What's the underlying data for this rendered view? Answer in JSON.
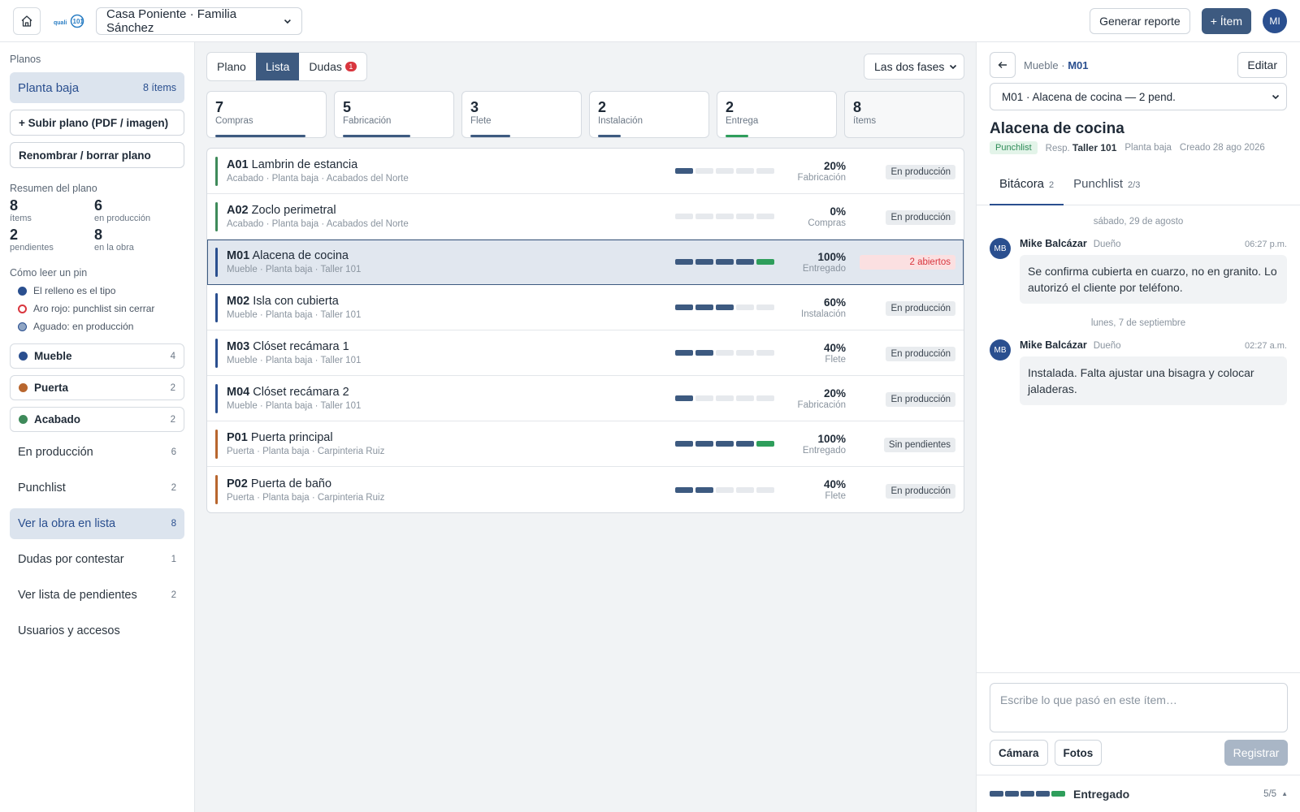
{
  "topbar": {
    "logo_text": "quali101",
    "project": "Casa Poniente · Familia Sánchez",
    "report_button": "Generar reporte",
    "add_item_button": "+ Ítem",
    "user_initials": "MI"
  },
  "sidebar": {
    "plans_heading": "Planos",
    "active_plan": {
      "name": "Planta baja",
      "count": "8 ítems"
    },
    "upload_button": "+ Subir plano (PDF / imagen)",
    "rename_button": "Renombrar / borrar plano",
    "summary_heading": "Resumen del plano",
    "summary": [
      {
        "value": "8",
        "label": "ítems"
      },
      {
        "value": "6",
        "label": "en producción"
      },
      {
        "value": "2",
        "label": "pendientes"
      },
      {
        "value": "8",
        "label": "en la obra"
      }
    ],
    "legend_heading": "Cómo leer un pin",
    "legend": [
      {
        "text": "El relleno es el tipo"
      },
      {
        "text": "Aro rojo: punchlist sin cerrar"
      },
      {
        "text": "Aguado: en producción"
      }
    ],
    "types": [
      {
        "name": "Mueble",
        "count": "4",
        "color": "#2a4f8f"
      },
      {
        "name": "Puerta",
        "count": "2",
        "color": "#b8662e"
      },
      {
        "name": "Acabado",
        "count": "2",
        "color": "#3e8a5a"
      }
    ],
    "nav": [
      {
        "label": "En producción",
        "count": "6"
      },
      {
        "label": "Punchlist",
        "count": "2"
      },
      {
        "label": "Ver la obra en lista",
        "count": "8"
      },
      {
        "label": "Dudas por contestar",
        "count": "1"
      },
      {
        "label": "Ver lista de pendientes",
        "count": "2"
      },
      {
        "label": "Usuarios y accesos",
        "count": ""
      }
    ]
  },
  "main": {
    "tabs": [
      {
        "label": "Plano"
      },
      {
        "label": "Lista"
      },
      {
        "label": "Dudas",
        "badge": "1"
      }
    ],
    "phase_filter": "Las dos fases",
    "kpis": [
      {
        "value": "7",
        "label": "Compras",
        "fill": 0.87
      },
      {
        "value": "5",
        "label": "Fabricación",
        "fill": 0.65
      },
      {
        "value": "3",
        "label": "Flete",
        "fill": 0.38
      },
      {
        "value": "2",
        "label": "Instalación",
        "fill": 0.22
      },
      {
        "value": "2",
        "label": "Entrega",
        "fill": 0.22
      },
      {
        "value": "8",
        "label": "ítems",
        "fill": 0
      }
    ],
    "items": [
      {
        "code": "A01",
        "name": "Lambrin de estancia",
        "sub": "Acabado · Planta baja · Acabados del Norte",
        "pct": "20%",
        "phase": "Fabricación",
        "steps": 1,
        "done": false,
        "status": "En producción",
        "alert": false,
        "color": "#3e8a5a"
      },
      {
        "code": "A02",
        "name": "Zoclo perimetral",
        "sub": "Acabado · Planta baja · Acabados del Norte",
        "pct": "0%",
        "phase": "Compras",
        "steps": 0,
        "done": false,
        "status": "En producción",
        "alert": false,
        "color": "#3e8a5a"
      },
      {
        "code": "M01",
        "name": "Alacena de cocina",
        "sub": "Mueble · Planta baja · Taller 101",
        "pct": "100%",
        "phase": "Entregado",
        "steps": 5,
        "done": true,
        "status": "2 abiertos",
        "alert": true,
        "color": "#2a4f8f"
      },
      {
        "code": "M02",
        "name": "Isla con cubierta",
        "sub": "Mueble · Planta baja · Taller 101",
        "pct": "60%",
        "phase": "Instalación",
        "steps": 3,
        "done": false,
        "status": "En producción",
        "alert": false,
        "color": "#2a4f8f"
      },
      {
        "code": "M03",
        "name": "Clóset recámara 1",
        "sub": "Mueble · Planta baja · Taller 101",
        "pct": "40%",
        "phase": "Flete",
        "steps": 2,
        "done": false,
        "status": "En producción",
        "alert": false,
        "color": "#2a4f8f"
      },
      {
        "code": "M04",
        "name": "Clóset recámara 2",
        "sub": "Mueble · Planta baja · Taller 101",
        "pct": "20%",
        "phase": "Fabricación",
        "steps": 1,
        "done": false,
        "status": "En producción",
        "alert": false,
        "color": "#2a4f8f"
      },
      {
        "code": "P01",
        "name": "Puerta principal",
        "sub": "Puerta · Planta baja · Carpinteria Ruiz",
        "pct": "100%",
        "phase": "Entregado",
        "steps": 5,
        "done": true,
        "status": "Sin pendientes",
        "alert": false,
        "color": "#b8662e"
      },
      {
        "code": "P02",
        "name": "Puerta de baño",
        "sub": "Puerta · Planta baja · Carpinteria Ruiz",
        "pct": "40%",
        "phase": "Flete",
        "steps": 2,
        "done": false,
        "status": "En producción",
        "alert": false,
        "color": "#b8662e"
      }
    ]
  },
  "panel": {
    "crumb_type": "Mueble · ",
    "crumb_code": "M01",
    "edit_button": "Editar",
    "item_select": "M01 · Alacena de cocina — 2 pend.",
    "title": "Alacena de cocina",
    "tag": "Punchlist",
    "resp_label": "Resp.",
    "resp_value": "Taller 101",
    "location": "Planta baja",
    "created": "Creado 28 ago 2026",
    "tabs": [
      {
        "label": "Bitácora",
        "count": "2"
      },
      {
        "label": "Punchlist",
        "count": "2/3"
      }
    ],
    "log": [
      {
        "day": "sábado, 29 de agosto",
        "initials": "MB",
        "who": "Mike Balcázar",
        "role": "Dueño",
        "time": "06:27 p.m.",
        "text": "Se confirma cubierta en cuarzo, no en granito. Lo autorizó el cliente por teléfono."
      },
      {
        "day": "lunes, 7 de septiembre",
        "initials": "MB",
        "who": "Mike Balcázar",
        "role": "Dueño",
        "time": "02:27 a.m.",
        "text": "Instalada. Falta ajustar una bisagra y colocar jaladeras."
      }
    ],
    "composer_placeholder": "Escribe lo que pasó en este ítem…",
    "camera_button": "Cámara",
    "photos_button": "Fotos",
    "register_button": "Registrar",
    "footer_status": "Entregado",
    "footer_count": "5/5"
  }
}
